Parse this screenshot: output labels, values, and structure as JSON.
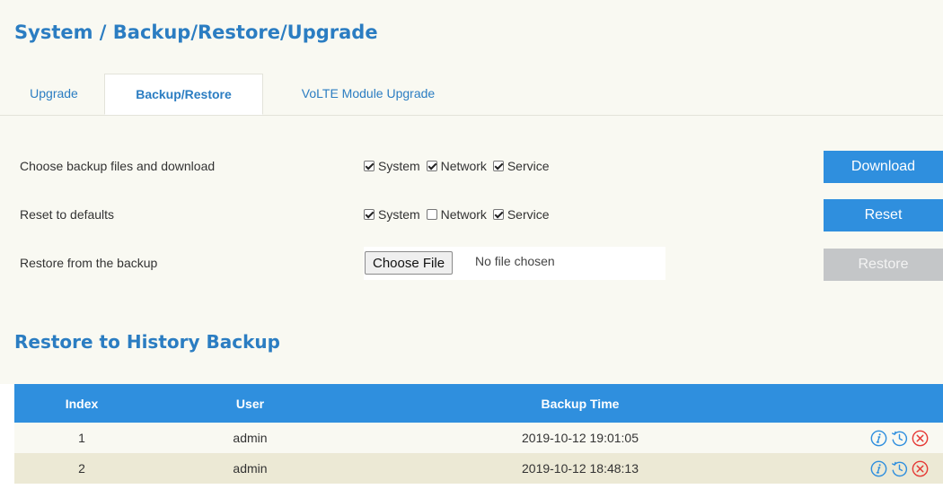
{
  "header": {
    "title": "System / Backup/Restore/Upgrade"
  },
  "tabs": [
    {
      "label": "Upgrade",
      "active": false
    },
    {
      "label": "Backup/Restore",
      "active": true
    },
    {
      "label": "VoLTE Module Upgrade",
      "active": false
    }
  ],
  "backup_row": {
    "label": "Choose backup files and download",
    "options": [
      {
        "label": "System",
        "checked": true
      },
      {
        "label": "Network",
        "checked": true
      },
      {
        "label": "Service",
        "checked": true
      }
    ],
    "button": "Download"
  },
  "reset_row": {
    "label": "Reset to defaults",
    "options": [
      {
        "label": "System",
        "checked": true
      },
      {
        "label": "Network",
        "checked": false
      },
      {
        "label": "Service",
        "checked": true
      }
    ],
    "button": "Reset"
  },
  "restore_row": {
    "label": "Restore from the backup",
    "file_button": "Choose File",
    "file_status": "No file chosen",
    "button": "Restore"
  },
  "history": {
    "title": "Restore to History Backup",
    "columns": [
      "Index",
      "User",
      "Backup Time",
      ""
    ],
    "rows": [
      {
        "index": "1",
        "user": "admin",
        "time": "2019-10-12 19:01:05"
      },
      {
        "index": "2",
        "user": "admin",
        "time": "2019-10-12 18:48:13"
      }
    ],
    "action_icons": [
      "info-icon",
      "restore-clock-icon",
      "delete-icon"
    ]
  },
  "colors": {
    "accent": "#2b7dc2",
    "button": "#2f8fde",
    "button_disabled": "#c4c6c8",
    "panel_bg": "#f9f9f2",
    "row_alt_bg": "#ece9d5",
    "delete_red": "#e53935"
  }
}
